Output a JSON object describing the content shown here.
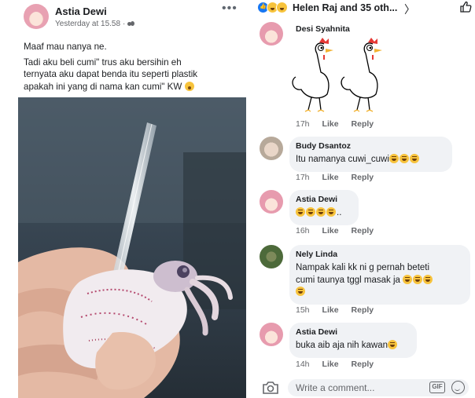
{
  "post": {
    "author": "Astia Dewi",
    "timestamp": "Yesterday at 15.58",
    "separator": "·",
    "more_label": "•••",
    "text_lines": [
      "Maaf mau nanya ne.",
      "Tadi aku beli cumi\" trus aku bersihin eh",
      "ternyata aku dapat benda itu seperti plastik",
      "apakah ini yang di nama kan cumi\" KW"
    ]
  },
  "reactions": {
    "summary": "Helen Raj and 35 oth...",
    "chevron": "〉"
  },
  "comments": [
    {
      "name": "Desi Syahnita",
      "text": "",
      "time": "17h",
      "like": "Like",
      "reply": "Reply"
    },
    {
      "name": "Budy Dsantoz",
      "text": "Itu namanya cuwi_cuwi",
      "emojis": 3,
      "time": "17h",
      "like": "Like",
      "reply": "Reply"
    },
    {
      "name": "Astia Dewi",
      "text": "..",
      "emojis": 4,
      "time": "16h",
      "like": "Like",
      "reply": "Reply"
    },
    {
      "name": "Nely Linda",
      "text_line1": "Nampak kali kk ni g pernah beteti",
      "text_line2": "cumi taunya tggl masak ja",
      "emojis": 4,
      "time": "15h",
      "like": "Like",
      "reply": "Reply"
    },
    {
      "name": "Astia Dewi",
      "text": "buka aib aja nih kawan",
      "emojis": 1,
      "time": "14h",
      "like": "Like",
      "reply": "Reply"
    }
  ],
  "composer": {
    "placeholder": "Write a comment...",
    "gif_label": "GIF"
  },
  "colors": {
    "facebook_blue": "#1877f2",
    "bubble_grey": "#f0f2f5",
    "meta_grey": "#65676b"
  }
}
